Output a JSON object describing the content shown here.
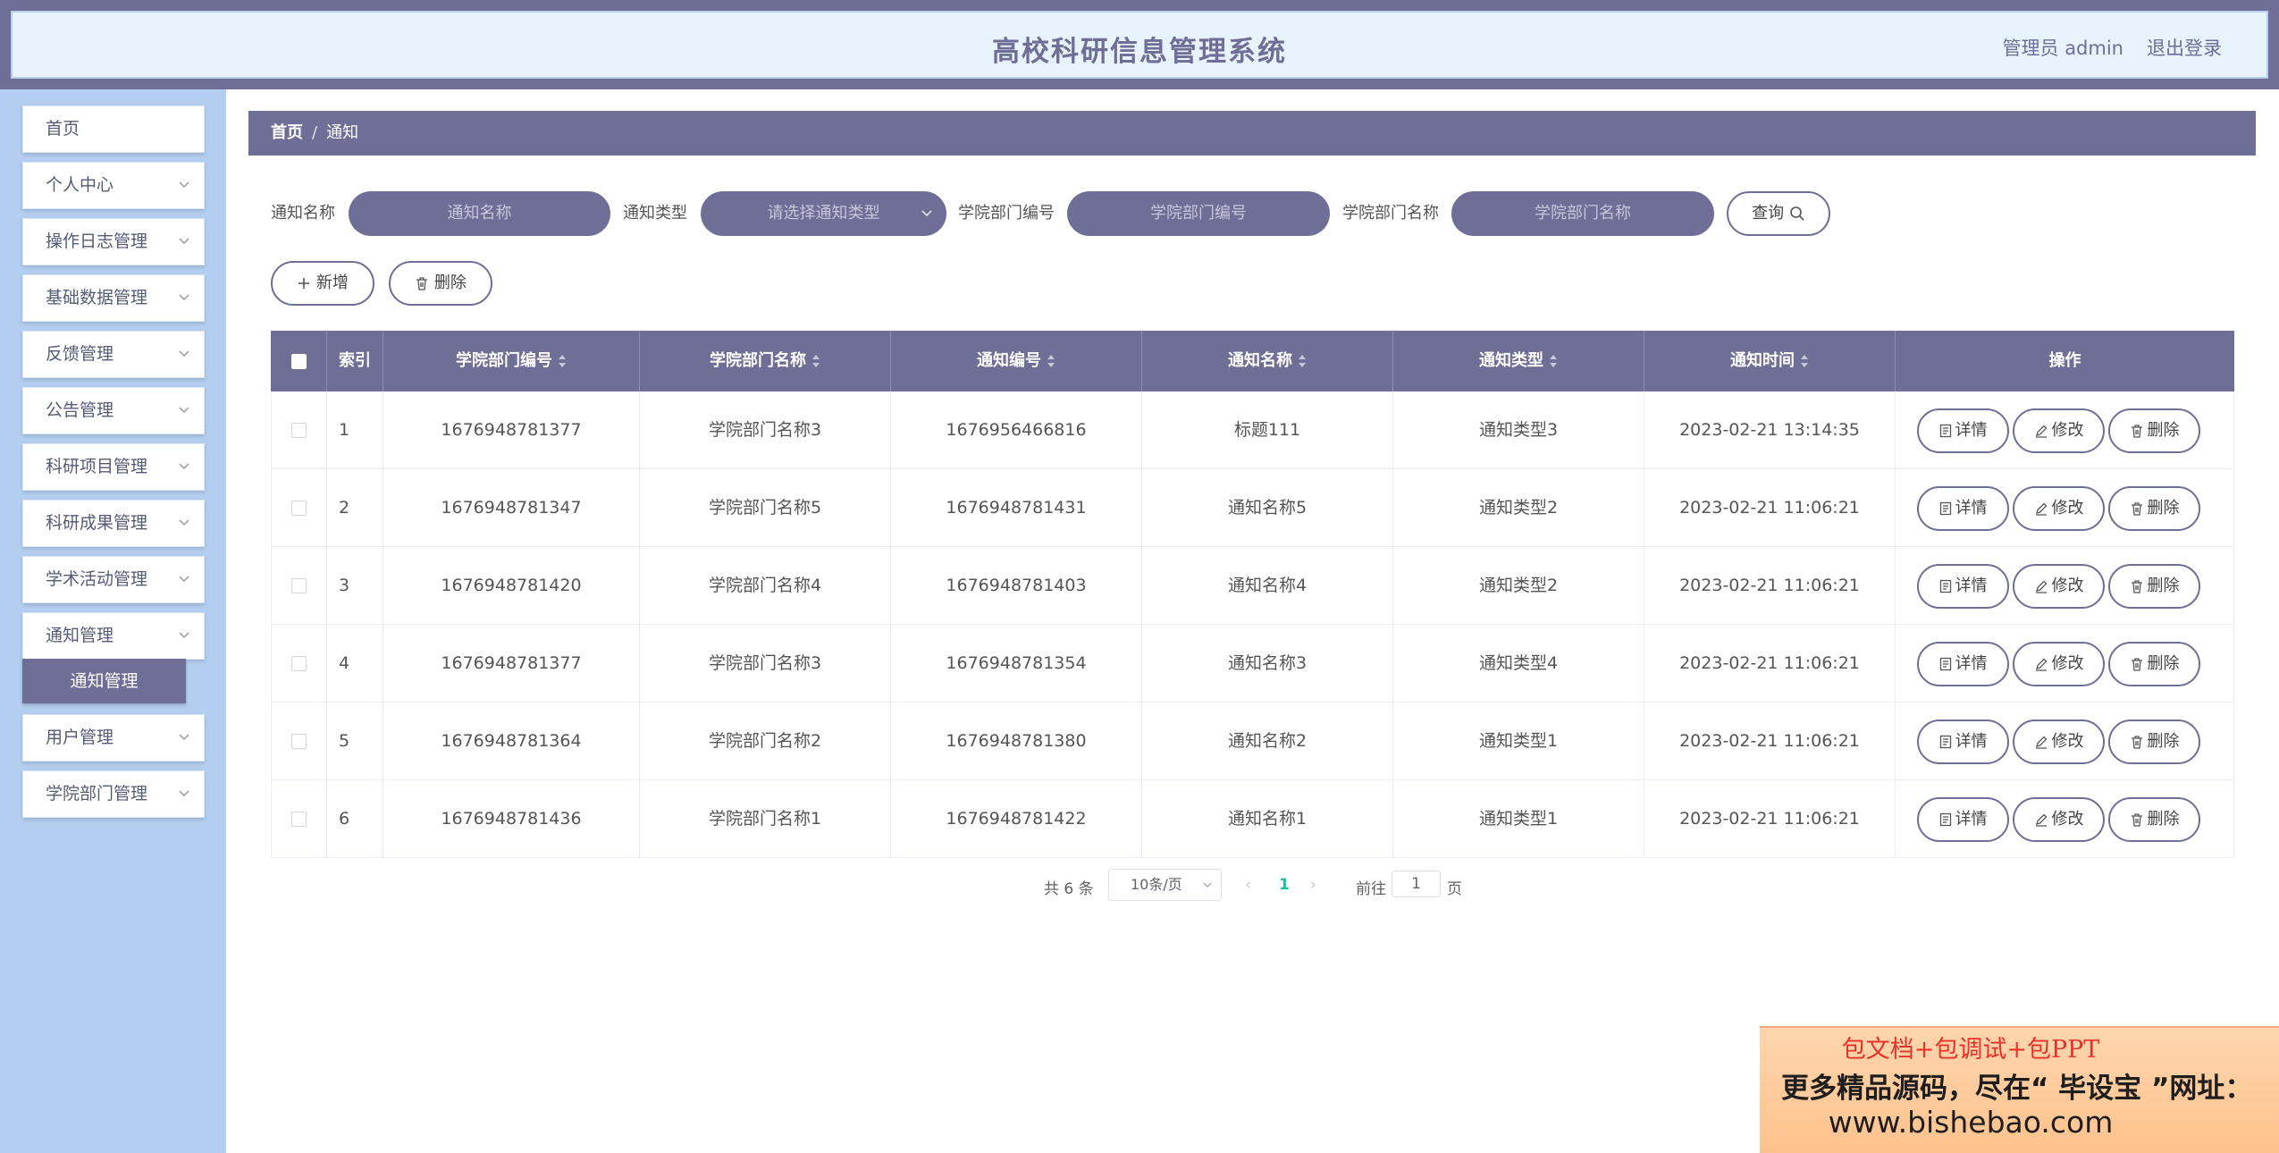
{
  "header": {
    "title": "高校科研信息管理系统",
    "user": "管理员 admin",
    "logout": "退出登录"
  },
  "sidebar": {
    "items": [
      {
        "label": "首页",
        "has_arrow": false
      },
      {
        "label": "个人中心",
        "has_arrow": true
      },
      {
        "label": "操作日志管理",
        "has_arrow": true
      },
      {
        "label": "基础数据管理",
        "has_arrow": true
      },
      {
        "label": "反馈管理",
        "has_arrow": true
      },
      {
        "label": "公告管理",
        "has_arrow": true
      },
      {
        "label": "科研项目管理",
        "has_arrow": true
      },
      {
        "label": "科研成果管理",
        "has_arrow": true
      },
      {
        "label": "学术活动管理",
        "has_arrow": true
      },
      {
        "label": "通知管理",
        "has_arrow": true,
        "expanded": true
      },
      {
        "label": "用户管理",
        "has_arrow": true
      },
      {
        "label": "学院部门管理",
        "has_arrow": true
      }
    ],
    "active_sub": "通知管理"
  },
  "breadcrumb": {
    "home": "首页",
    "sep": "/",
    "current": "通知"
  },
  "search": {
    "notice_name_label": "通知名称",
    "notice_name_placeholder": "通知名称",
    "notice_type_label": "通知类型",
    "notice_type_placeholder": "请选择通知类型",
    "dept_no_label": "学院部门编号",
    "dept_no_placeholder": "学院部门编号",
    "dept_name_label": "学院部门名称",
    "dept_name_placeholder": "学院部门名称",
    "query_button": "查询"
  },
  "actions": {
    "add_button": "新增",
    "delete_button": "删除"
  },
  "table": {
    "columns": [
      "索引",
      "学院部门编号",
      "学院部门名称",
      "通知编号",
      "通知名称",
      "通知类型",
      "通知时间",
      "操作"
    ],
    "rows": [
      {
        "index": "1",
        "dept_no": "1676948781377",
        "dept_name": "学院部门名称3",
        "notice_no": "1676956466816",
        "notice_name": "标题111",
        "notice_type": "通知类型3",
        "time": "2023-02-21 13:14:35"
      },
      {
        "index": "2",
        "dept_no": "1676948781347",
        "dept_name": "学院部门名称5",
        "notice_no": "1676948781431",
        "notice_name": "通知名称5",
        "notice_type": "通知类型2",
        "time": "2023-02-21 11:06:21"
      },
      {
        "index": "3",
        "dept_no": "1676948781420",
        "dept_name": "学院部门名称4",
        "notice_no": "1676948781403",
        "notice_name": "通知名称4",
        "notice_type": "通知类型2",
        "time": "2023-02-21 11:06:21"
      },
      {
        "index": "4",
        "dept_no": "1676948781377",
        "dept_name": "学院部门名称3",
        "notice_no": "1676948781354",
        "notice_name": "通知名称3",
        "notice_type": "通知类型4",
        "time": "2023-02-21 11:06:21"
      },
      {
        "index": "5",
        "dept_no": "1676948781364",
        "dept_name": "学院部门名称2",
        "notice_no": "1676948781380",
        "notice_name": "通知名称2",
        "notice_type": "通知类型1",
        "time": "2023-02-21 11:06:21"
      },
      {
        "index": "6",
        "dept_no": "1676948781436",
        "dept_name": "学院部门名称1",
        "notice_no": "1676948781422",
        "notice_name": "通知名称1",
        "notice_type": "通知类型1",
        "time": "2023-02-21 11:06:21"
      }
    ],
    "row_actions": {
      "detail": "详情",
      "edit": "修改",
      "delete": "删除"
    }
  },
  "pagination": {
    "total": "共 6 条",
    "page_size": "10条/页",
    "prev": "‹",
    "current_page": "1",
    "next": "›",
    "goto_label": "前往",
    "goto_value": "1",
    "goto_unit": "页"
  },
  "ad_banner": {
    "line1": "包文档+包调试+包PPT",
    "line2": "更多精品源码，尽在“ 毕设宝 ”网址：",
    "line3": "www.bishebao.com"
  },
  "colors": {
    "primary": "#6e6e96",
    "sidebar_bg": "#b3cef0",
    "header_bg": "#e6f3fb",
    "page_active": "#13c39b"
  }
}
